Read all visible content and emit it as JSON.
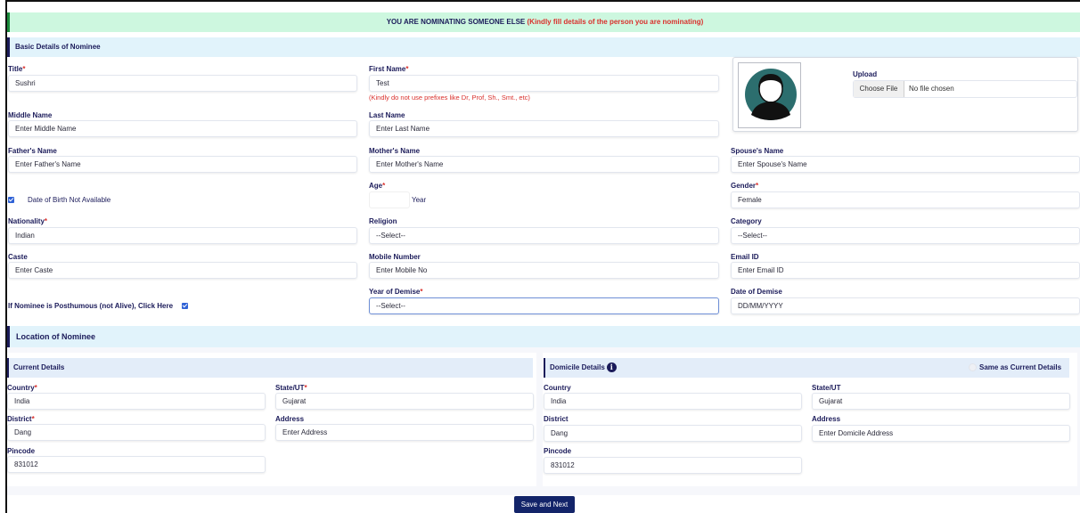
{
  "banner": {
    "main": "YOU ARE NOMINATING SOMEONE ELSE",
    "note": "(Kindly fill details of the person you are nominating)"
  },
  "basic": {
    "heading": "Basic Details of Nominee",
    "title": {
      "label": "Title",
      "value": "Sushri"
    },
    "first_name": {
      "label": "First Name",
      "value": "Test",
      "hint": "(Kindly do not use prefixes like Dr, Prof, Sh., Smt., etc)"
    },
    "middle_name": {
      "label": "Middle Name",
      "placeholder": "Enter Middle Name"
    },
    "last_name": {
      "label": "Last Name",
      "placeholder": "Enter Last Name"
    },
    "fathers_name": {
      "label": "Father's Name",
      "placeholder": "Enter Father's Name"
    },
    "mothers_name": {
      "label": "Mother's Name",
      "placeholder": "Enter Mother's Name"
    },
    "spouses_name": {
      "label": "Spouse's Name",
      "placeholder": "Enter Spouse's Name"
    },
    "dob_na": {
      "label": "Date of Birth Not Available",
      "checked": true
    },
    "age": {
      "label": "Age",
      "value": "",
      "unit": "Year"
    },
    "gender": {
      "label": "Gender",
      "value": "Female"
    },
    "nationality": {
      "label": "Nationality",
      "value": "Indian"
    },
    "religion": {
      "label": "Religion",
      "value": "--Select--"
    },
    "category": {
      "label": "Category",
      "value": "--Select--"
    },
    "caste": {
      "label": "Caste",
      "placeholder": "Enter Caste"
    },
    "mobile": {
      "label": "Mobile Number",
      "placeholder": "Enter Mobile No"
    },
    "email": {
      "label": "Email ID",
      "placeholder": "Enter Email ID"
    },
    "posthumous": {
      "label": "If Nominee is Posthumous (not Alive), Click Here",
      "checked": true
    },
    "year_of_demise": {
      "label": "Year of Demise",
      "value": "--Select--"
    },
    "date_of_demise": {
      "label": "Date of Demise",
      "placeholder": "DD/MM/YYYY"
    },
    "upload": {
      "label": "Upload",
      "button": "Choose File",
      "file": "No file chosen"
    }
  },
  "location": {
    "heading": "Location of Nominee",
    "current": {
      "heading": "Current Details",
      "country": {
        "label": "Country",
        "value": "India"
      },
      "state": {
        "label": "State/UT",
        "value": "Gujarat"
      },
      "district": {
        "label": "District",
        "value": "Dang"
      },
      "address": {
        "label": "Address",
        "placeholder": "Enter Address"
      },
      "pincode": {
        "label": "Pincode",
        "value": "831012"
      }
    },
    "domicile": {
      "heading": "Domicile Details",
      "info_icon_glyph": "i",
      "same_as": "Same as Current Details",
      "country": {
        "label": "Country",
        "value": "India"
      },
      "state": {
        "label": "State/UT",
        "value": "Gujarat"
      },
      "district": {
        "label": "District",
        "value": "Dang"
      },
      "address": {
        "label": "Address",
        "placeholder": "Enter Domicile Address"
      },
      "pincode": {
        "label": "Pincode",
        "value": "831012"
      }
    }
  },
  "actions": {
    "save_label": "Save and Next"
  },
  "colors": {
    "accent": "#1b1b5a",
    "required": "#d9302c",
    "banner_bg": "#cdf7df",
    "section_bg": "#e1f3fb",
    "button_bg": "#132469"
  },
  "icons": {
    "avatar": "avatar-icon",
    "checkbox": "checkbox-checked-icon",
    "info": "info-icon"
  }
}
